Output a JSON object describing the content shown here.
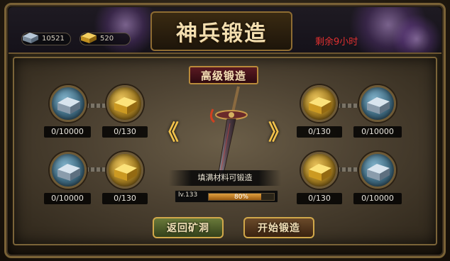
{
  "header": {
    "title": "神兵锻造",
    "remaining_time": "剩余9小时"
  },
  "resources": {
    "silver": {
      "icon": "silver-ingot-icon",
      "value": "10521"
    },
    "gold": {
      "icon": "gold-ingot-icon",
      "value": "520"
    }
  },
  "forge": {
    "banner": "高级锻造",
    "fill_hint": "填满材料可锻造",
    "level": "lv.133",
    "progress_percent": 80,
    "progress_text": "80%",
    "prev_arrow": "《",
    "next_arrow": "》"
  },
  "slots": {
    "left_top_silver": "0/10000",
    "left_top_gold": "0/130",
    "left_bottom_silver": "0/10000",
    "left_bottom_gold": "0/130",
    "right_top_gold": "0/130",
    "right_top_silver": "0/10000",
    "right_bottom_gold": "0/130",
    "right_bottom_silver": "0/10000"
  },
  "buttons": {
    "back": "返回矿洞",
    "start": "开始锻造"
  },
  "colors": {
    "accent_gold": "#f0c04a",
    "remaining_red": "#e03030",
    "frame_bronze": "#7a6236"
  }
}
